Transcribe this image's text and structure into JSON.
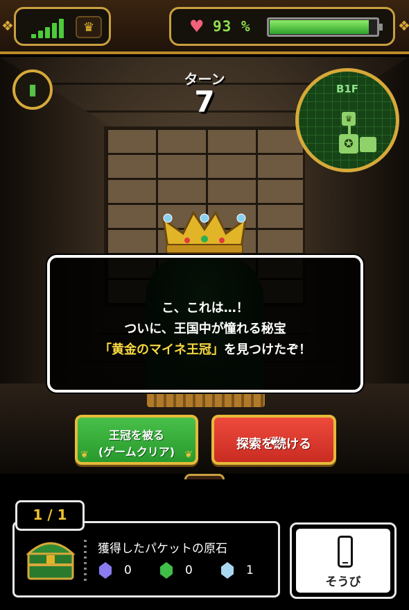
{
  "status_bar": {
    "signal_level": 5,
    "hp_percent_text": "93 %",
    "hp_fraction": 0.93,
    "icons": {
      "crown": "crown-icon",
      "heart": "heart-icon"
    }
  },
  "turn": {
    "label": "ターン",
    "number": "7"
  },
  "minimap": {
    "floor": "B1F"
  },
  "message": {
    "line1": "こ、これは…！",
    "line2": "ついに、王国中が憧れる秘宝",
    "line3_highlight": "「黄金のマイネ王冠」",
    "line3_rest": "を見つけたぞ！"
  },
  "choices": {
    "wear_crown_line1": "王冠を被る",
    "wear_crown_line2": "(ゲームクリア)",
    "continue_label": "探索を続ける"
  },
  "inventory": {
    "count": "1 / 1",
    "title": "獲得したパケットの原石",
    "gems": [
      {
        "color": "#8a7cf0",
        "value": "0"
      },
      {
        "color": "#3fbf4a",
        "value": "0"
      },
      {
        "color": "#a9d6ef",
        "value": "1"
      }
    ]
  },
  "equip": {
    "label": "そうび"
  },
  "colors": {
    "accent_gold": "#d6a93a",
    "hp_green": "#8de04e",
    "highlight": "#f7d742"
  }
}
